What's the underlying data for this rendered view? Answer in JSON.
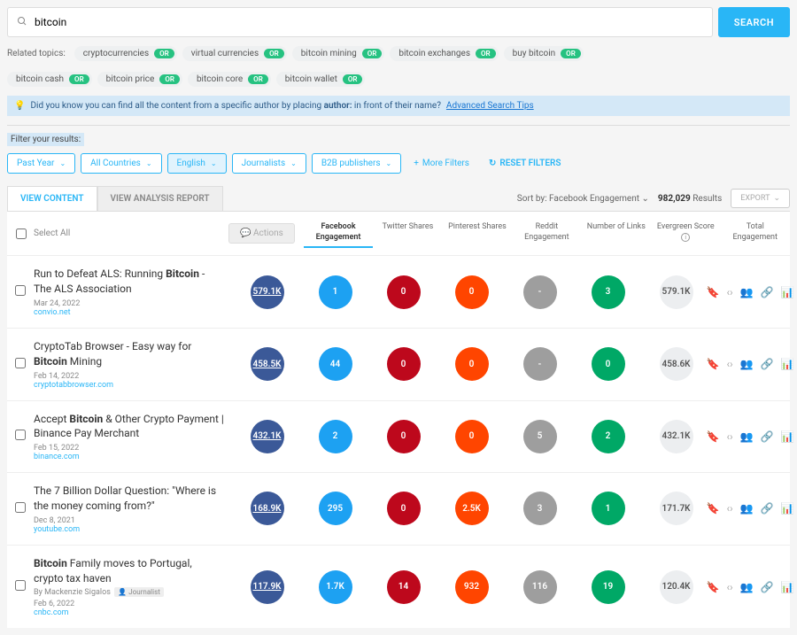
{
  "search": {
    "query": "bitcoin",
    "button": "SEARCH"
  },
  "related": {
    "label": "Related topics:",
    "or": "OR",
    "topics": [
      "cryptocurrencies",
      "virtual currencies",
      "bitcoin mining",
      "bitcoin exchanges",
      "buy bitcoin",
      "bitcoin cash",
      "bitcoin price",
      "bitcoin core",
      "bitcoin wallet"
    ]
  },
  "tip": {
    "prefix": "Did you know you can find all the content from a specific author by placing ",
    "bold": "author:",
    "suffix": " in front of their name?",
    "link": "Advanced Search Tips"
  },
  "filters": {
    "label": "Filter your results:",
    "items": [
      "Past Year",
      "All Countries",
      "English",
      "Journalists",
      "B2B publishers"
    ],
    "active_index": 2,
    "more": "More Filters",
    "reset": "RESET FILTERS"
  },
  "tabs": {
    "content": "VIEW CONTENT",
    "analysis": "VIEW ANALYSIS REPORT"
  },
  "sort": {
    "prefix": "Sort by:",
    "value": "Facebook Engagement",
    "count": "982,029",
    "results_label": "Results"
  },
  "export": "EXPORT",
  "table": {
    "select_all": "Select All",
    "actions": "Actions",
    "headers": [
      "Facebook Engagement",
      "Twitter Shares",
      "Pinterest Shares",
      "Reddit Engagement",
      "Number of Links",
      "Evergreen Score",
      "Total Engagement"
    ]
  },
  "rows": [
    {
      "title_pre": "Run to Defeat ALS: Running ",
      "title_bold": "Bitcoin",
      "title_post": " - The ALS Association",
      "author": "",
      "date": "Mar 24, 2022",
      "source": "convio.net",
      "metrics": {
        "fb": "579.1K",
        "tw": "1",
        "pn": "0",
        "rd": "0",
        "lk": "-",
        "eg": "3",
        "total": "579.1K"
      },
      "underline_fb": true
    },
    {
      "title_pre": "CryptoTab Browser - Easy way for ",
      "title_bold": "Bitcoin",
      "title_post": " Mining",
      "author": "",
      "date": "Feb 14, 2022",
      "source": "cryptotabbrowser.com",
      "metrics": {
        "fb": "458.5K",
        "tw": "44",
        "pn": "0",
        "rd": "0",
        "lk": "-",
        "eg": "0",
        "total": "458.6K"
      },
      "underline_fb": true
    },
    {
      "title_pre": "Accept ",
      "title_bold": "Bitcoin",
      "title_post": " & Other Crypto Payment | Binance Pay Merchant",
      "author": "",
      "date": "Feb 15, 2022",
      "source": "binance.com",
      "metrics": {
        "fb": "432.1K",
        "tw": "2",
        "pn": "0",
        "rd": "0",
        "lk": "5",
        "eg": "2",
        "total": "432.1K"
      },
      "underline_fb": true
    },
    {
      "title_pre": "The 7 Billion Dollar Question: \"Where is the money coming from?\"",
      "title_bold": "",
      "title_post": "",
      "author": "",
      "date": "Dec 8, 2021",
      "source": "youtube.com",
      "metrics": {
        "fb": "168.9K",
        "tw": "295",
        "pn": "0",
        "rd": "2.5K",
        "lk": "3",
        "eg": "1",
        "total": "171.7K"
      },
      "underline_fb": true
    },
    {
      "title_pre": "",
      "title_bold": "Bitcoin",
      "title_post": " Family moves to Portugal, crypto tax haven",
      "author": "By Mackenzie Sigalos",
      "journalist": "Journalist",
      "date": "Feb 6, 2022",
      "source": "cnbc.com",
      "metrics": {
        "fb": "117.9K",
        "tw": "1.7K",
        "pn": "14",
        "rd": "932",
        "lk": "116",
        "eg": "19",
        "total": "120.4K"
      },
      "underline_fb": true
    }
  ]
}
